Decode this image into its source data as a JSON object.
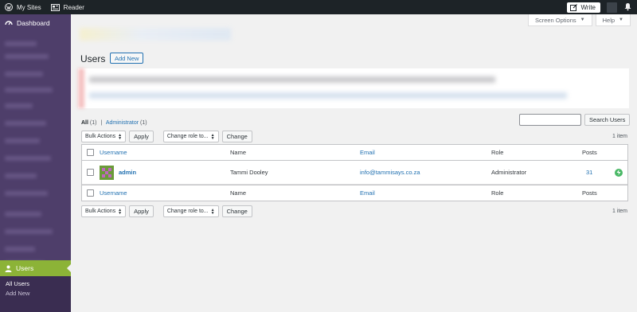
{
  "topbar": {
    "my_sites": "My Sites",
    "reader": "Reader",
    "write": "Write"
  },
  "sidebar": {
    "dashboard": "Dashboard",
    "users": "Users",
    "sub_items": [
      "All Users",
      "Add New"
    ]
  },
  "screen_options": {
    "screen_options": "Screen Options",
    "help": "Help"
  },
  "page": {
    "title": "Users",
    "add_new": "Add New"
  },
  "filters": {
    "all_label": "All",
    "all_count": "(1)",
    "separator": "|",
    "admin_label": "Administrator",
    "admin_count": "(1)"
  },
  "search": {
    "button": "Search Users",
    "value": ""
  },
  "tablenav": {
    "bulk_actions": "Bulk Actions",
    "apply": "Apply",
    "change_role": "Change role to...",
    "change": "Change",
    "count": "1 item"
  },
  "table": {
    "columns": [
      "Username",
      "Name",
      "Email",
      "Role",
      "Posts"
    ],
    "rows": [
      {
        "username": "admin",
        "name": "Tammi Dooley",
        "email": "info@tammisays.co.za",
        "role": "Administrator",
        "posts": "31"
      }
    ]
  },
  "colors": {
    "sidebar": "#4e3e6a",
    "active_menu": "#8cb337",
    "link": "#2271b1",
    "badge": "#4ab866"
  }
}
